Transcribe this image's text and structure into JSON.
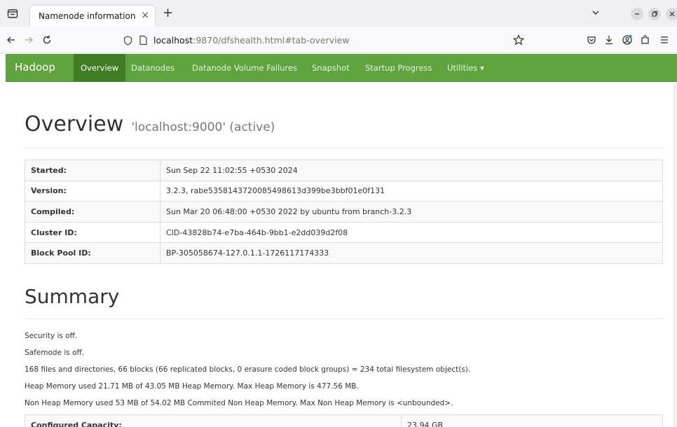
{
  "browser": {
    "tab_title": "Namenode information",
    "tab_close": "×",
    "new_tab": "+",
    "url_host": "localhost",
    "url_rest": ":9870/dfshealth.html#tab-overview"
  },
  "hadoop_nav": {
    "brand": "Hadoop",
    "items": [
      "Overview",
      "Datanodes",
      "Datanode Volume Failures",
      "Snapshot",
      "Startup Progress",
      "Utilities ▾"
    ],
    "active_index": 0
  },
  "overview": {
    "title": "Overview",
    "subtitle": "'localhost:9000' (active)",
    "rows": [
      {
        "key": "Started:",
        "value": "Sun Sep 22 11:02:55 +0530 2024"
      },
      {
        "key": "Version:",
        "value": "3.2.3, rabe5358143720085498613d399be3bbf01e0f131"
      },
      {
        "key": "Compiled:",
        "value": "Sun Mar 20 06:48:00 +0530 2022 by ubuntu from branch-3.2.3"
      },
      {
        "key": "Cluster ID:",
        "value": "CID-43828b74-e7ba-464b-9bb1-e2dd039d2f08"
      },
      {
        "key": "Block Pool ID:",
        "value": "BP-305058674-127.0.1.1-1726117174333"
      }
    ]
  },
  "summary": {
    "title": "Summary",
    "lines": [
      "Security is off.",
      "Safemode is off.",
      "168 files and directories, 66 blocks (66 replicated blocks, 0 erasure coded block groups) = 234 total filesystem object(s).",
      "Heap Memory used 21.71 MB of 43.05 MB Heap Memory. Max Heap Memory is 477.56 MB.",
      "Non Heap Memory used 53 MB of 54.02 MB Commited Non Heap Memory. Max Non Heap Memory is <unbounded>."
    ],
    "capacity_key": "Configured Capacity:",
    "capacity_value": "23.94 GB"
  },
  "colors": {
    "hadoop_green": "#5fa33e",
    "hadoop_active": "#3f7c24"
  }
}
